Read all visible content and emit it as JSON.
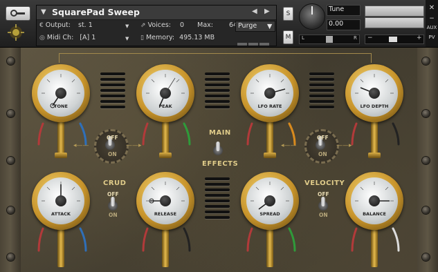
{
  "header": {
    "instrument_name": "SquarePad Sweep",
    "output_label": "Output:",
    "output_value": "st. 1",
    "voices_label": "Voices:",
    "voices_value": "0",
    "max_label": "Max:",
    "max_value": "64",
    "purge_label": "Purge",
    "midi_label": "Midi Ch:",
    "midi_value": "[A]  1",
    "memory_label": "Memory:",
    "memory_value": "495.13 MB",
    "solo_label": "S",
    "mute_label": "M",
    "tune_label": "Tune",
    "tune_value": "0.00",
    "pan_left": "L",
    "pan_right": "R",
    "vol_minus": "−",
    "vol_plus": "+",
    "close_label": "✕",
    "aux_label": "AUX",
    "pv_label": "PV"
  },
  "controls": {
    "knobs": [
      {
        "label": "TONE"
      },
      {
        "label": "PEAK"
      },
      {
        "label": "LFO RATE"
      },
      {
        "label": "LFO DEPTH"
      },
      {
        "label": "ATTACK"
      },
      {
        "label": "RELEASE"
      },
      {
        "label": "SPREAD"
      },
      {
        "label": "BALANCE"
      }
    ],
    "switch_off": "OFF",
    "switch_on": "ON",
    "main_label": "MAIN",
    "effects_label": "EFFECTS",
    "crud_label": "CRUD",
    "velocity_label": "VELOCITY"
  },
  "colors": {
    "brass": "#c8942b",
    "panel": "#4f4838",
    "wire_red": "#b23a3a",
    "wire_blue": "#2f6fb8",
    "wire_green": "#2f9a3a",
    "wire_orange": "#d88a1e",
    "wire_white": "#dddddd"
  }
}
